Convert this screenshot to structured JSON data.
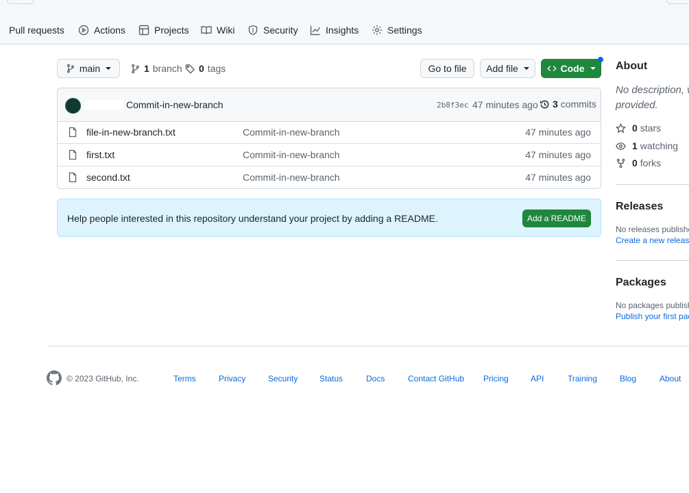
{
  "nav": {
    "tabs": [
      {
        "label": "Pull requests",
        "icon": "pull-request-icon"
      },
      {
        "label": "Actions",
        "icon": "play-icon"
      },
      {
        "label": "Projects",
        "icon": "table-icon"
      },
      {
        "label": "Wiki",
        "icon": "book-icon"
      },
      {
        "label": "Security",
        "icon": "shield-icon"
      },
      {
        "label": "Insights",
        "icon": "graph-icon"
      },
      {
        "label": "Settings",
        "icon": "gear-icon"
      }
    ]
  },
  "toolbar": {
    "branch_name": "main",
    "branch_count": "1",
    "branch_word": "branch",
    "tag_count": "0",
    "tag_word": "tags",
    "go_to_file": "Go to file",
    "add_file": "Add file",
    "code": "Code"
  },
  "commit": {
    "message": "Commit-in-new-branch",
    "hash": "2b8f3ec",
    "time": "47 minutes ago",
    "commit_count": "3",
    "commit_word": "commits"
  },
  "files": [
    {
      "name": "file-in-new-branch.txt",
      "message": "Commit-in-new-branch",
      "time": "47 minutes ago"
    },
    {
      "name": "first.txt",
      "message": "Commit-in-new-branch",
      "time": "47 minutes ago"
    },
    {
      "name": "second.txt",
      "message": "Commit-in-new-branch",
      "time": "47 minutes ago"
    }
  ],
  "readme_banner": {
    "text": "Help people interested in this repository understand your project by adding a README.",
    "button": "Add a README"
  },
  "about": {
    "title": "About",
    "description": "No description, w",
    "description_line2": "provided.",
    "stars_count": "0",
    "stars_word": "stars",
    "watching_count": "1",
    "watching_word": "watching",
    "forks_count": "0",
    "forks_word": "forks"
  },
  "releases": {
    "title": "Releases",
    "empty": "No releases published",
    "create_link": "Create a new release"
  },
  "packages": {
    "title": "Packages",
    "empty": "No packages published",
    "publish_link": "Publish your first packa"
  },
  "footer": {
    "copyright": "© 2023 GitHub, Inc.",
    "links": [
      "Terms",
      "Privacy",
      "Security",
      "Status",
      "Docs",
      "Contact GitHub",
      "Pricing",
      "API",
      "Training",
      "Blog",
      "About"
    ]
  },
  "colors": {
    "accent": "#0969da",
    "code_button": "#1f883d",
    "readme_bg": "#ddf4ff"
  }
}
